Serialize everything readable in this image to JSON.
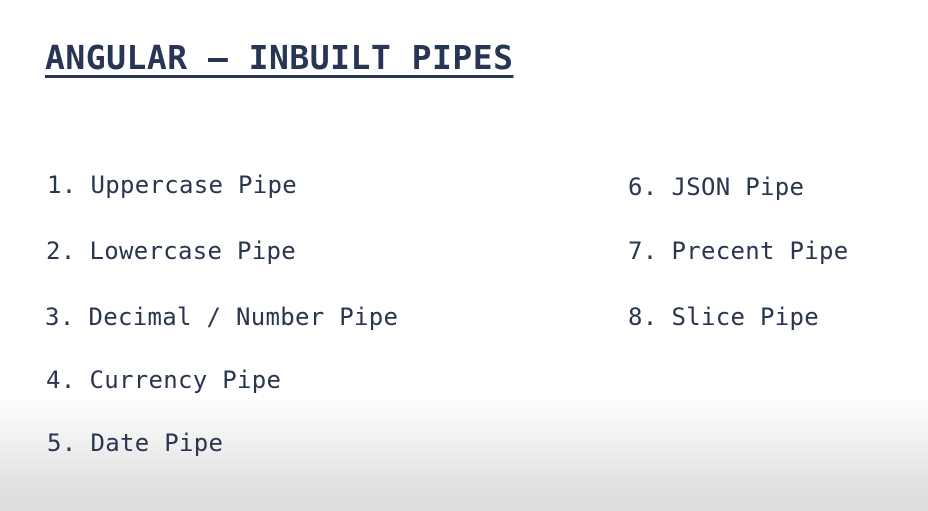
{
  "slide": {
    "title": "ANGULAR – INBUILT PIPES",
    "items": [
      {
        "number": "1.",
        "label": "Uppercase Pipe"
      },
      {
        "number": "2.",
        "label": "Lowercase Pipe"
      },
      {
        "number": "3.",
        "label": "Decimal / Number Pipe"
      },
      {
        "number": "4.",
        "label": "Currency Pipe"
      },
      {
        "number": "5.",
        "label": "Date Pipe"
      },
      {
        "number": "6.",
        "label": "JSON Pipe"
      },
      {
        "number": "7.",
        "label": "Precent Pipe"
      },
      {
        "number": "8.",
        "label": "Slice Pipe"
      }
    ],
    "colors": {
      "title": "#283655",
      "text": "#2a3550"
    }
  }
}
